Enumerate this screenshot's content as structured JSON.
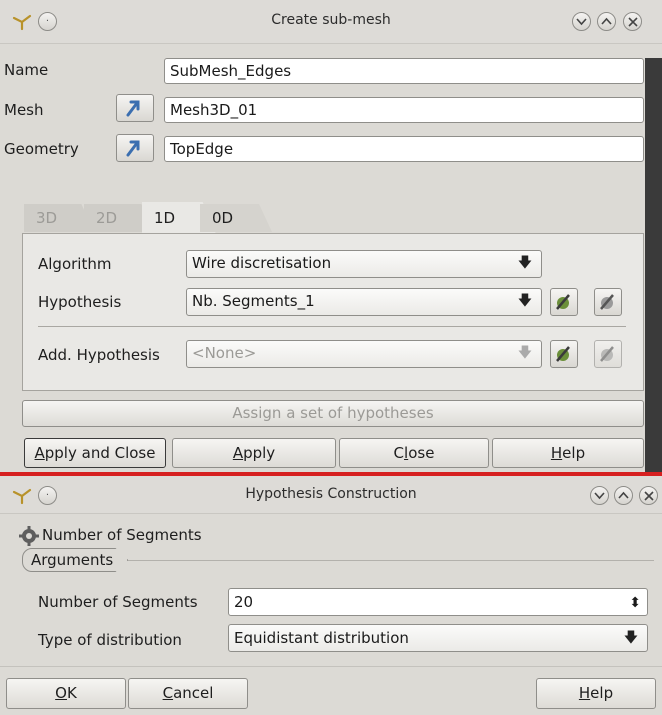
{
  "submesh_dialog": {
    "title": "Create sub-mesh",
    "name_label": "Name",
    "name_value": "SubMesh_Edges",
    "mesh_label": "Mesh",
    "mesh_value": "Mesh3D_01",
    "geometry_label": "Geometry",
    "geometry_value": "TopEdge",
    "tabs": [
      {
        "label": "3D",
        "active": false
      },
      {
        "label": "2D",
        "active": false
      },
      {
        "label": "1D",
        "active": true
      },
      {
        "label": "0D",
        "active": false
      }
    ],
    "algorithm_label": "Algorithm",
    "algorithm_value": "Wire discretisation",
    "hypothesis_label": "Hypothesis",
    "hypothesis_value": "Nb. Segments_1",
    "add_hypothesis_label": "Add. Hypothesis",
    "add_hypothesis_value": "<None>",
    "assign_button": "Assign a set of hypotheses",
    "apply_close_prefix": "A",
    "apply_close_rest": "pply and Close",
    "apply_prefix": "A",
    "apply_rest": "pply",
    "close_prefix": "C",
    "close_underline": "l",
    "close_rest": "ose",
    "help_prefix": "",
    "help_underline": "H",
    "help_rest": "elp"
  },
  "hypothesis_dialog": {
    "title": "Hypothesis Construction",
    "heading": "Number of Segments",
    "group_label": "Arguments",
    "segments_label": "Number of Segments",
    "segments_value": "20",
    "distribution_label": "Type of distribution",
    "distribution_value": "Equidistant distribution",
    "ok_underline": "O",
    "ok_rest": "K",
    "cancel_underline": "C",
    "cancel_rest": "ancel",
    "help_underline": "H",
    "help_rest": "elp"
  },
  "icons": {
    "window_menu": "pin-icon",
    "sticky": "circle-icon",
    "minimize": "chevron-down-icon",
    "maximize": "chevron-up-icon",
    "close": "close-icon",
    "select": "arrow-select-icon",
    "hypothesis_edit": "hypothesis-edit-icon",
    "hypothesis_new": "hypothesis-new-icon",
    "dropdown": "dropdown-arrow-icon",
    "spin": "spin-arrows-icon"
  },
  "colors": {
    "window_bg": "#dcdad5",
    "accent_blue": "#3b6fb0",
    "separator_red": "#d62020"
  }
}
